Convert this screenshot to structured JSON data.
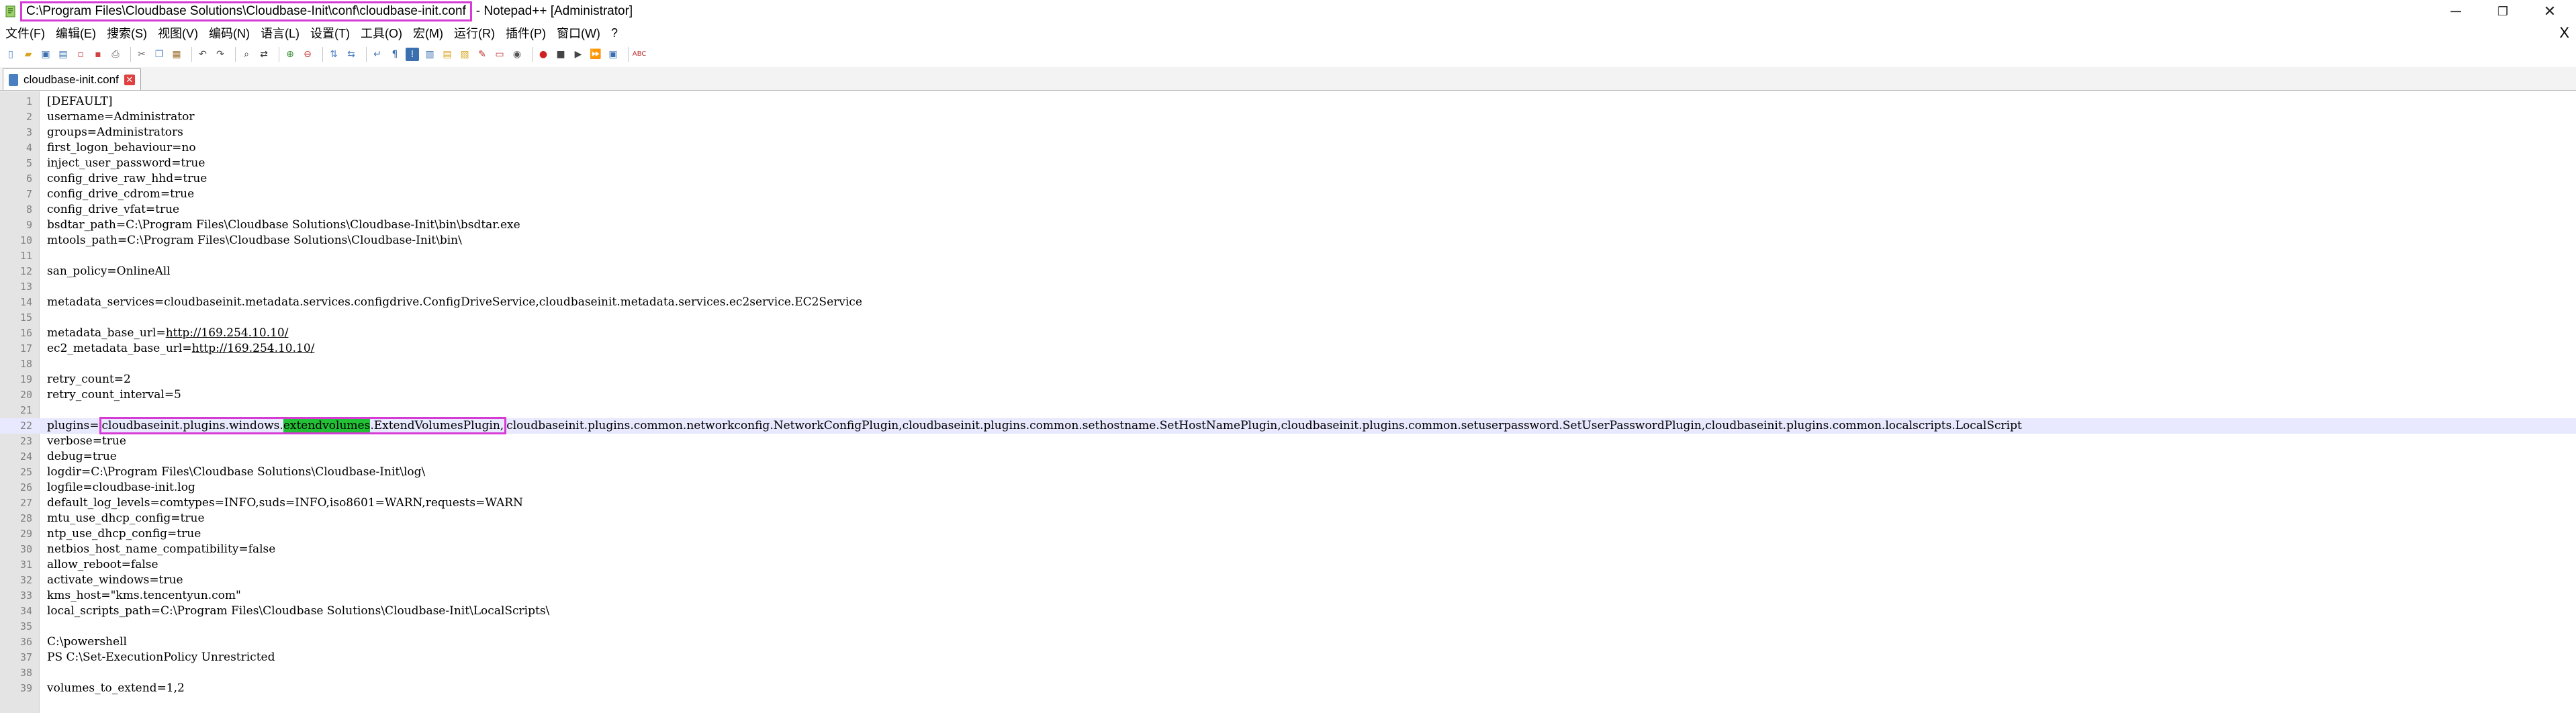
{
  "window": {
    "title_path": "C:\\Program Files\\Cloudbase Solutions\\Cloudbase-Init\\conf\\cloudbase-init.conf",
    "title_app": "- Notepad++ [Administrator]",
    "minimize": "─",
    "restore": "❐",
    "close": "✕"
  },
  "menu": {
    "items": [
      "文件(F)",
      "编辑(E)",
      "搜索(S)",
      "视图(V)",
      "编码(N)",
      "语言(L)",
      "设置(T)",
      "工具(O)",
      "宏(M)",
      "运行(R)",
      "插件(P)",
      "窗口(W)",
      "?"
    ],
    "close": "X"
  },
  "toolbar": {
    "buttons": [
      "new-file-icon",
      "open-file-icon",
      "save-icon",
      "save-all-icon",
      "close-icon",
      "close-all-icon",
      "print-icon",
      "cut-icon",
      "copy-icon",
      "paste-icon",
      "undo-icon",
      "redo-icon",
      "find-icon",
      "replace-icon",
      "zoom-in-icon",
      "zoom-out-icon",
      "sync-vertical-icon",
      "sync-horizontal-icon",
      "word-wrap-icon",
      "show-all-chars-icon",
      "indent-guide-icon",
      "doc-map-icon",
      "function-list-icon",
      "folder-workspace-icon",
      "monitor-icon",
      "record-macro-icon",
      "stop-macro-icon",
      "play-macro-icon",
      "run-macro-multiple-icon",
      "save-macro-icon",
      "spellcheck-icon"
    ]
  },
  "tab": {
    "label": "cloudbase-init.conf",
    "close": "✕"
  },
  "editor": {
    "lines": [
      {
        "n": "1",
        "text": "[DEFAULT]"
      },
      {
        "n": "2",
        "text": "username=Administrator"
      },
      {
        "n": "3",
        "text": "groups=Administrators"
      },
      {
        "n": "4",
        "text": "first_logon_behaviour=no"
      },
      {
        "n": "5",
        "text": "inject_user_password=true"
      },
      {
        "n": "6",
        "text": "config_drive_raw_hhd=true"
      },
      {
        "n": "7",
        "text": "config_drive_cdrom=true"
      },
      {
        "n": "8",
        "text": "config_drive_vfat=true"
      },
      {
        "n": "9",
        "text": "bsdtar_path=C:\\Program Files\\Cloudbase Solutions\\Cloudbase-Init\\bin\\bsdtar.exe"
      },
      {
        "n": "10",
        "text": "mtools_path=C:\\Program Files\\Cloudbase Solutions\\Cloudbase-Init\\bin\\"
      },
      {
        "n": "11",
        "text": ""
      },
      {
        "n": "12",
        "text": "san_policy=OnlineAll"
      },
      {
        "n": "13",
        "text": ""
      },
      {
        "n": "14",
        "text": "metadata_services=cloudbaseinit.metadata.services.configdrive.ConfigDriveService,cloudbaseinit.metadata.services.ec2service.EC2Service"
      },
      {
        "n": "15",
        "text": ""
      },
      {
        "n": "16",
        "text": "metadata_base_url=",
        "url": "http://169.254.10.10/"
      },
      {
        "n": "17",
        "text": "ec2_metadata_base_url=",
        "url": "http://169.254.10.10/"
      },
      {
        "n": "18",
        "text": ""
      },
      {
        "n": "19",
        "text": "retry_count=2"
      },
      {
        "n": "20",
        "text": "retry_count_interval=5"
      },
      {
        "n": "21",
        "text": ""
      },
      {
        "n": "22",
        "prefix": "plugins=",
        "box_a": "cloudbaseinit.plugins.windows.",
        "highlight": "extendvolumes",
        "box_b": ".ExtendVolumesPlugin,",
        "rest": "cloudbaseinit.plugins.common.networkconfig.NetworkConfigPlugin,cloudbaseinit.plugins.common.sethostname.SetHostNamePlugin,cloudbaseinit.plugins.common.setuserpassword.SetUserPasswordPlugin,cloudbaseinit.plugins.common.localscripts.LocalScript"
      },
      {
        "n": "23",
        "text": "verbose=true"
      },
      {
        "n": "24",
        "text": "debug=true"
      },
      {
        "n": "25",
        "text": "logdir=C:\\Program Files\\Cloudbase Solutions\\Cloudbase-Init\\log\\"
      },
      {
        "n": "26",
        "text": "logfile=cloudbase-init.log"
      },
      {
        "n": "27",
        "text": "default_log_levels=comtypes=INFO,suds=INFO,iso8601=WARN,requests=WARN"
      },
      {
        "n": "28",
        "text": "mtu_use_dhcp_config=true"
      },
      {
        "n": "29",
        "text": "ntp_use_dhcp_config=true"
      },
      {
        "n": "30",
        "text": "netbios_host_name_compatibility=false"
      },
      {
        "n": "31",
        "text": "allow_reboot=false"
      },
      {
        "n": "32",
        "text": "activate_windows=true"
      },
      {
        "n": "33",
        "text": "kms_host=\"kms.tencentyun.com\""
      },
      {
        "n": "34",
        "text": "local_scripts_path=C:\\Program Files\\Cloudbase Solutions\\Cloudbase-Init\\LocalScripts\\"
      },
      {
        "n": "35",
        "text": ""
      },
      {
        "n": "36",
        "text": "C:\\powershell"
      },
      {
        "n": "37",
        "text": "PS C:\\Set-ExecutionPolicy Unrestricted"
      },
      {
        "n": "38",
        "text": ""
      },
      {
        "n": "39",
        "text": "volumes_to_extend=1,2"
      }
    ]
  }
}
